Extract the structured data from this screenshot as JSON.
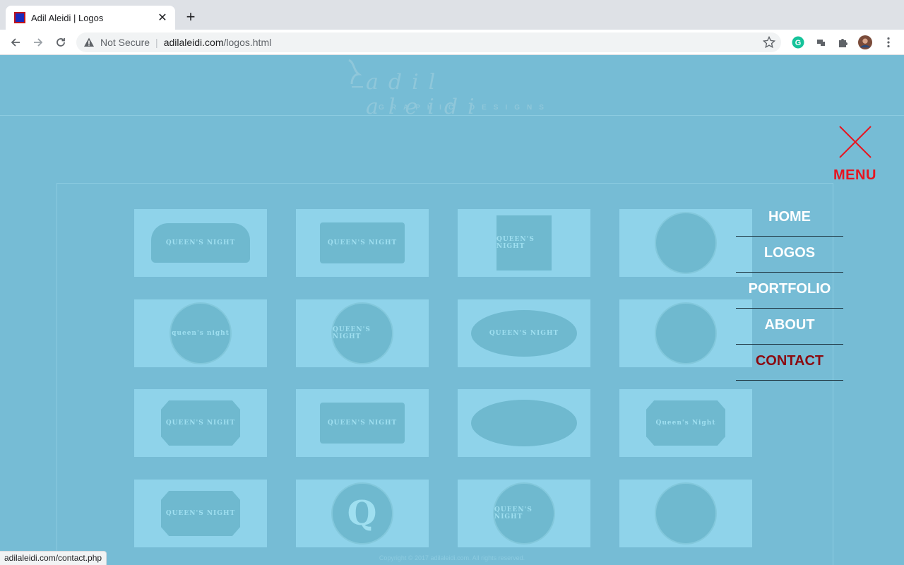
{
  "browser": {
    "tab_title": "Adil Aleidi | Logos",
    "security_label": "Not Secure",
    "url_domain": "adilaleidi.com",
    "url_path": "/logos.html",
    "status_url": "adilaleidi.com/contact.php"
  },
  "site": {
    "logo_text": "adil aleidi",
    "logo_subtitle": "GRAPHIC DESIGNS",
    "copyright": "Copyright © 2017 adilaleidi.com. All rights reserved."
  },
  "menu": {
    "label": "MENU",
    "items": [
      {
        "label": "HOME"
      },
      {
        "label": "LOGOS"
      },
      {
        "label": "PORTFOLIO"
      },
      {
        "label": "ABOUT"
      },
      {
        "label": "CONTACT"
      }
    ],
    "active_color": "#8b0a10",
    "close_color": "#e8141f"
  },
  "logos": [
    {
      "text": "QUEEN'S NIGHT",
      "shape": "banner"
    },
    {
      "text": "QUEEN'S NIGHT",
      "shape": "rect"
    },
    {
      "text": "QUEEN'S NIGHT",
      "shape": "square"
    },
    {
      "text": "",
      "shape": "circle"
    },
    {
      "text": "queen's night",
      "shape": "circle"
    },
    {
      "text": "QUEEN'S NIGHT",
      "shape": "circle"
    },
    {
      "text": "QUEEN'S NIGHT",
      "shape": "oval"
    },
    {
      "text": "",
      "shape": "circle"
    },
    {
      "text": "QUEEN'S NIGHT",
      "shape": "ribbon"
    },
    {
      "text": "QUEEN'S NIGHT",
      "shape": "rect"
    },
    {
      "text": "",
      "shape": "oval"
    },
    {
      "text": "Queen's Night",
      "shape": "ribbon"
    },
    {
      "text": "QUEEN'S NIGHT",
      "shape": "ribbon"
    },
    {
      "text": "Q",
      "shape": "circle"
    },
    {
      "text": "QUEEN'S NIGHT",
      "shape": "circle"
    },
    {
      "text": "",
      "shape": "circle"
    }
  ]
}
